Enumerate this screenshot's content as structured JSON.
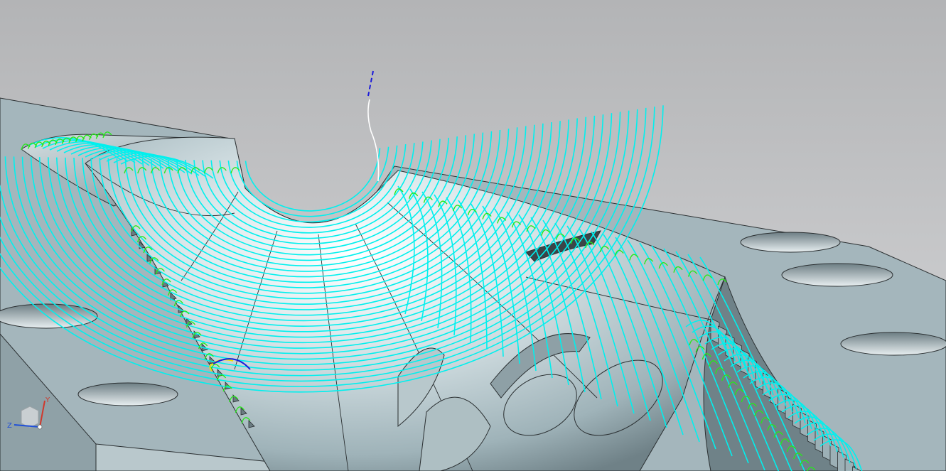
{
  "viewport": {
    "background_top": "#b3b4b6",
    "background_bottom": "#d6d7d9"
  },
  "model": {
    "face_color": "#a4b6bc",
    "face_dark": "#8a9ca2",
    "face_light": "#c7d4d8",
    "edge_color": "#2a2f31"
  },
  "toolpath": {
    "cut_color": "#00f0ee",
    "engage_color": "#27e81b",
    "retract_color": "#ffffff",
    "rapid_color": "#1a1adb",
    "tool_marker_color": "#f2e200"
  },
  "triad": {
    "x_color": "#1f4fd8",
    "y_color": "#d0382c",
    "z_label": "Z",
    "y_label": "Y"
  }
}
